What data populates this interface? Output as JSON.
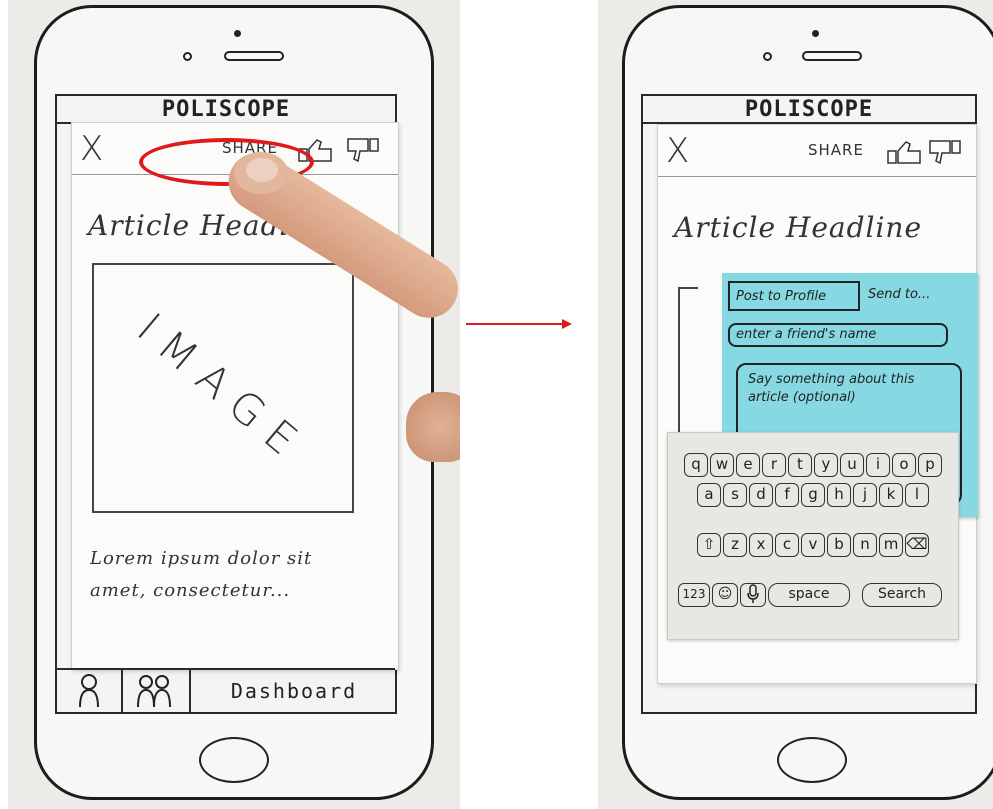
{
  "app_title": "POLISCOPE",
  "toolbar": {
    "close_label": "X",
    "share_label": "SHARE",
    "like_icon": "thumbs-up-icon",
    "dislike_icon": "thumbs-down-icon"
  },
  "article": {
    "headline_left": "Article Headli",
    "headline_right": "Article Headline",
    "image_placeholder": "IMAGE",
    "lorem": "Lorem ipsum dolor sit amet, consectetur..."
  },
  "tabbar": {
    "tab1_icon": "person-icon",
    "tab2_icon": "group-icon",
    "tab3_label": "Dashboard"
  },
  "highlight_color": "#e01a1a",
  "share_panel": {
    "post_tab": "Post to Profile",
    "send_tab": "Send to...",
    "friend_placeholder": "enter a friend's name",
    "comment_placeholder": "Say something about this article (optional)",
    "note_color": "#86d9e2"
  },
  "keyboard": {
    "row1": [
      "q",
      "w",
      "e",
      "r",
      "t",
      "y",
      "u",
      "i",
      "o",
      "p"
    ],
    "row2": [
      "a",
      "s",
      "d",
      "f",
      "g",
      "h",
      "j",
      "k",
      "l"
    ],
    "row3": [
      "⇧",
      "z",
      "x",
      "c",
      "v",
      "b",
      "n",
      "m",
      "⌫"
    ],
    "num_key": "123",
    "emoji_key": "☺",
    "mic_key": "🎤",
    "space_label": "space",
    "search_label": "Search"
  }
}
